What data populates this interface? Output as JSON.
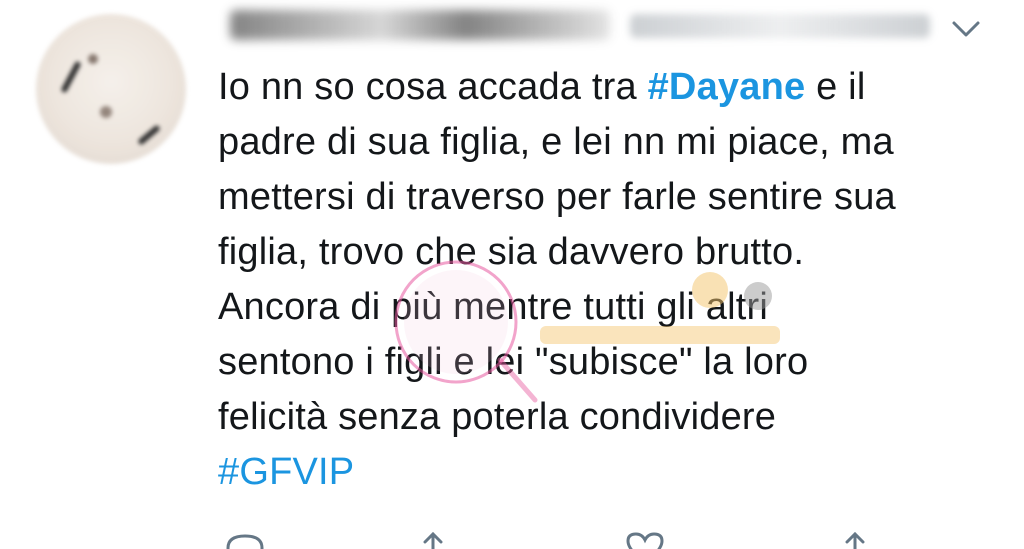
{
  "tweet": {
    "lines": [
      [
        "Io nn so cosa accada tra ",
        "#Dayane",
        " e il"
      ],
      [
        "padre di sua figlia, e lei nn mi piace, ma"
      ],
      [
        "mettersi di traverso per farle sentire sua"
      ],
      [
        "figlia, trovo che sia davvero brutto."
      ],
      [
        "Ancora di più mentre tutti gli altri"
      ],
      [
        "sentono i figli e lei \"subisce\" la loro"
      ],
      [
        "felicità senza poterla condividere"
      ]
    ],
    "hashtag_bottom": "#GFVIP"
  },
  "icons": {
    "menu": "chevron-down-icon",
    "reply": "reply-icon",
    "retweet": "retweet-icon",
    "like": "heart-icon",
    "share": "share-icon"
  },
  "colors": {
    "text": "#14171a",
    "hashtag": "#1b95e0",
    "icon": "#657786",
    "watermark": "#e85aa0"
  }
}
